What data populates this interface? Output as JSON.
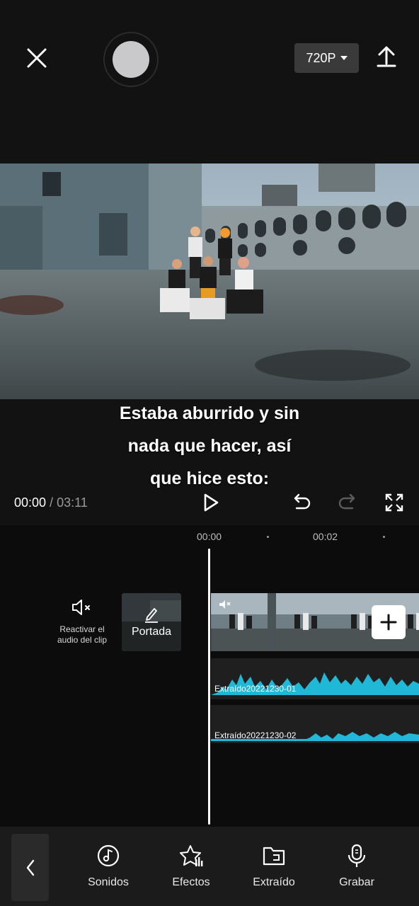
{
  "topbar": {
    "resolution": "720P"
  },
  "subtitle": {
    "lines": [
      "Estaba aburrido y sin",
      "nada que hacer, así",
      "que hice esto:"
    ]
  },
  "playback": {
    "current_time": "00:00",
    "separator": " / ",
    "total_time": "03:11"
  },
  "timeline": {
    "ruler": [
      "00:00",
      "00:02"
    ],
    "mute_label_line1": "Reactivar el",
    "mute_label_line2": "audio del clip",
    "cover_label": "Portada",
    "audio_tracks": [
      "Extraído20221230-01",
      "Extraído20221230-02"
    ]
  },
  "toolbar": {
    "items": [
      {
        "label": "Sonidos",
        "icon": "music-disc-icon"
      },
      {
        "label": "Efectos",
        "icon": "star-effects-icon"
      },
      {
        "label": "Extraído",
        "icon": "extracted-folder-icon"
      },
      {
        "label": "Grabar",
        "icon": "microphone-icon"
      }
    ]
  },
  "colors": {
    "waveform": "#1fb8d6",
    "background": "#121212",
    "timeline": "#0c0c0c"
  }
}
